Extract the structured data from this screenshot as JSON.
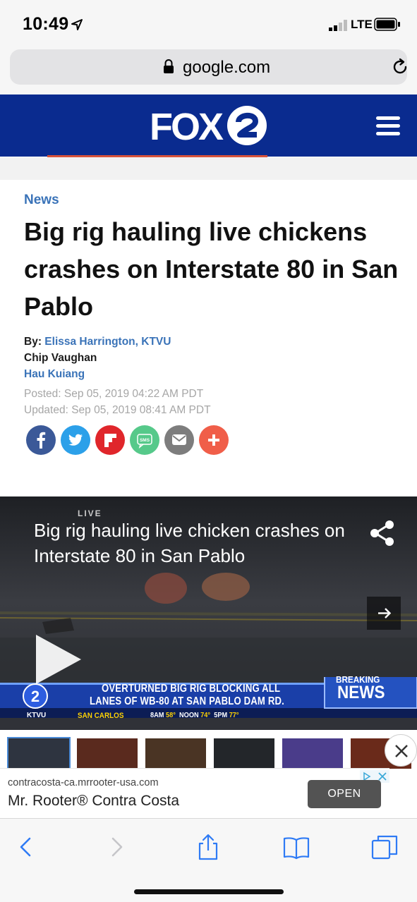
{
  "status_bar": {
    "time": "10:49",
    "network": "LTE"
  },
  "browser": {
    "url": "google.com"
  },
  "header": {
    "logo_text": "FOX 2"
  },
  "article": {
    "section": "News",
    "headline": "Big rig hauling live chickens crashes on Interstate 80 in San Pablo",
    "by_prefix": "By:",
    "authors": [
      "Elissa Harrington, KTVU",
      "Chip Vaughan",
      "Hau Kuiang"
    ],
    "posted": "Posted: Sep 05, 2019 04:22 AM PDT",
    "updated": "Updated: Sep 05, 2019 08:41 AM PDT",
    "share_buttons": [
      {
        "name": "facebook",
        "color": "#3b5998"
      },
      {
        "name": "twitter",
        "color": "#2ca0e9"
      },
      {
        "name": "flipboard",
        "color": "#e0262b"
      },
      {
        "name": "sms",
        "color": "#56c98a"
      },
      {
        "name": "email",
        "color": "#7d7d7d"
      },
      {
        "name": "more",
        "color": "#f05e49"
      }
    ]
  },
  "video": {
    "title": "Big rig hauling live chicken crashes on Interstate 80 in San Pablo",
    "live_tag": "LIVE",
    "ticker_line1": "OVERTURNED BIG RIG BLOCKING ALL",
    "ticker_line2": "LANES OF WB-80 AT SAN PABLO DAM RD.",
    "breaking": "BREAKING",
    "news": "NEWS",
    "station": "KTVU",
    "location": "SAN CARLOS",
    "weather": [
      "8AM",
      "58°",
      "NOON",
      "74°",
      "5PM",
      "77°"
    ]
  },
  "ad": {
    "url": "contracosta-ca.mrrooter-usa.com",
    "title": "Mr. Rooter® Contra Costa",
    "cta": "OPEN"
  },
  "colors": {
    "header_blue": "#0a2b8f",
    "link_blue": "#3a73b8",
    "accent_red": "#d8523a",
    "ios_blue": "#2f7bf5"
  }
}
